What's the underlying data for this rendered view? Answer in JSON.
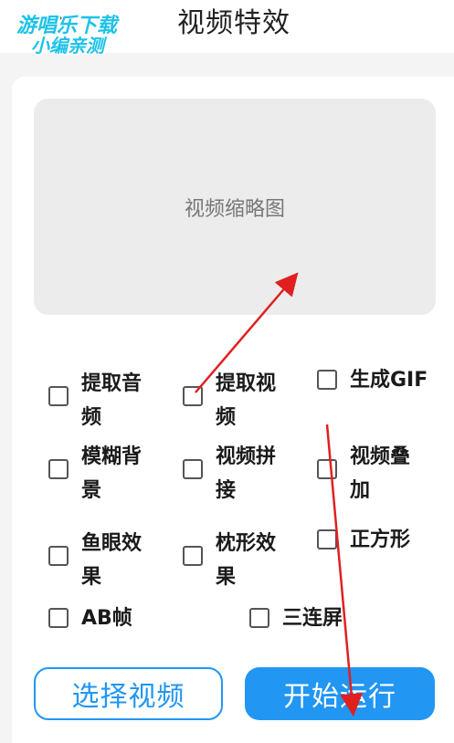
{
  "header": {
    "title": "视频特效",
    "back_icon": "chevron-left-icon"
  },
  "watermark": {
    "line1": "游唱乐下载",
    "line2": "小编亲测"
  },
  "preview": {
    "label": "视频缩略图"
  },
  "options": [
    {
      "id": "extract-audio",
      "label": "提取音频",
      "checked": false
    },
    {
      "id": "extract-video",
      "label": "提取视频",
      "checked": false
    },
    {
      "id": "generate-gif",
      "label": "生成GIF",
      "checked": false
    },
    {
      "id": "blur-background",
      "label": "模糊背景",
      "checked": false
    },
    {
      "id": "video-splice",
      "label": "视频拼接",
      "checked": false
    },
    {
      "id": "video-overlay",
      "label": "视频叠加",
      "checked": false
    },
    {
      "id": "fisheye",
      "label": "鱼眼效果",
      "checked": false
    },
    {
      "id": "pillow",
      "label": "枕形效果",
      "checked": false
    },
    {
      "id": "square",
      "label": "正方形",
      "checked": false
    },
    {
      "id": "ab-frame",
      "label": "AB帧",
      "checked": false
    },
    {
      "id": "triple-screen",
      "label": "三连屏",
      "checked": false
    }
  ],
  "buttons": {
    "select_video": "选择视频",
    "start_run": "开始运行"
  },
  "colors": {
    "accent": "#2196f3",
    "annotation_arrow": "#e02020"
  }
}
